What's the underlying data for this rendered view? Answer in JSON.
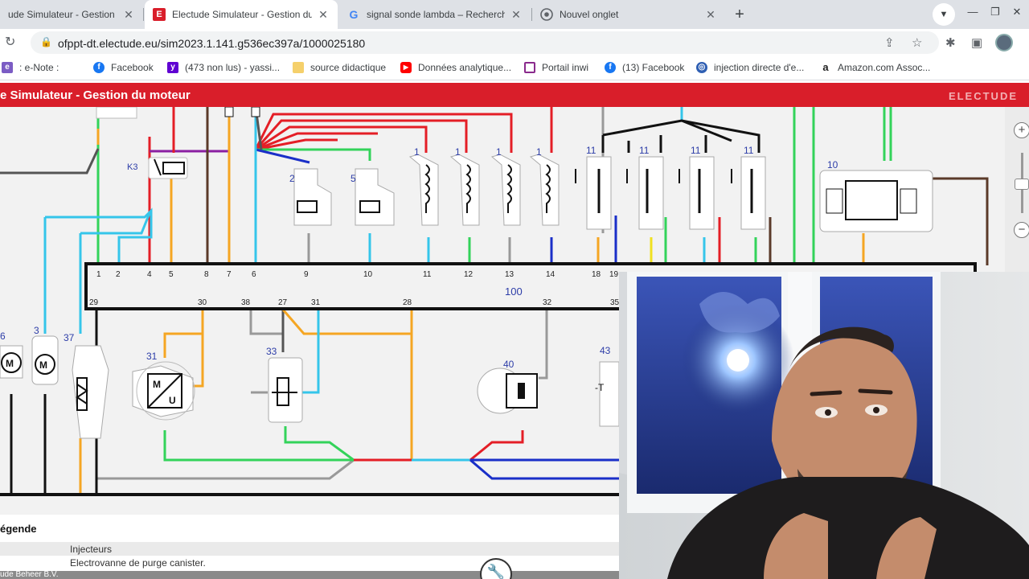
{
  "browser": {
    "tabs": [
      {
        "title": "ude Simulateur - Gestion du",
        "favicon": "electude-icon",
        "active": false
      },
      {
        "title": "Electude Simulateur - Gestion du",
        "favicon": "electude-icon",
        "active": true
      },
      {
        "title": "signal sonde lambda – Recherche",
        "favicon": "google-icon",
        "active": false
      },
      {
        "title": "Nouvel onglet",
        "favicon": "chrome-icon",
        "active": false
      }
    ],
    "new_tab_label": "+",
    "url": "ofppt-dt.electude.eu/sim2023.1.141.g536ec397a/1000025180",
    "bookmarks": [
      {
        "label": ": e-Note :",
        "icon": "enote-icon",
        "color": "#7b5cc4"
      },
      {
        "label": "Facebook",
        "icon": "facebook-icon",
        "color": "#1877f2"
      },
      {
        "label": "(473 non lus) - yassi...",
        "icon": "yahoo-icon",
        "color": "#6001d2"
      },
      {
        "label": "source didactique",
        "icon": "folder-icon",
        "color": "#f5d06b"
      },
      {
        "label": "Données analytique...",
        "icon": "youtube-icon",
        "color": "#ff0000"
      },
      {
        "label": "Portail inwi",
        "icon": "inwi-icon",
        "color": "#8a2a8c"
      },
      {
        "label": "(13) Facebook",
        "icon": "facebook-icon",
        "color": "#1877f2"
      },
      {
        "label": "injection directe d'e...",
        "icon": "site-icon",
        "color": "#2f5fb3"
      },
      {
        "label": "Amazon.com Assoc...",
        "icon": "amazon-icon",
        "color": "#222222"
      }
    ]
  },
  "app": {
    "title": "e Simulateur - Gestion du moteur",
    "logo": "ELECTUDE",
    "accent": "#d91e2a"
  },
  "diagram": {
    "component_labels": {
      "k3": "K3",
      "c2": "2",
      "c5": "5",
      "c10": "10",
      "c100": "100",
      "c31": "31",
      "c33": "33",
      "c40": "40",
      "c43": "43",
      "c37": "37",
      "c3": "3",
      "c6": "6",
      "inj": [
        "1",
        "1",
        "1",
        "1"
      ],
      "coil": [
        "11",
        "11",
        "11",
        "11"
      ]
    },
    "connector_top_pins": [
      "1",
      "2",
      "4",
      "5",
      "8",
      "7",
      "6",
      "9",
      "10",
      "11",
      "12",
      "13",
      "14",
      "18",
      "19"
    ],
    "connector_bottom_pins": [
      "29",
      "30",
      "38",
      "27",
      "31",
      "28",
      "32",
      "35"
    ]
  },
  "legend": {
    "title": "égende",
    "rows": [
      "Injecteurs",
      "Electrovanne de purge canister."
    ],
    "footer": "ude Beheer B.V."
  }
}
